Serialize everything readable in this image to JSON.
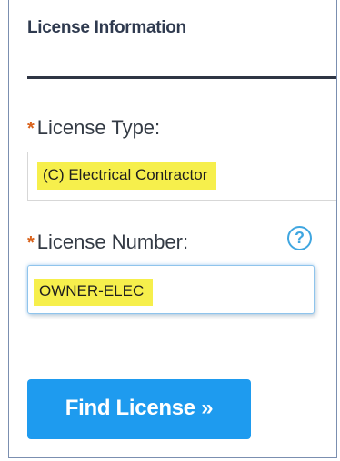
{
  "panel": {
    "title": "License Information"
  },
  "license_type": {
    "required_marker": "*",
    "label": "License Type:",
    "value": "(C) Electrical Contractor"
  },
  "license_number": {
    "required_marker": "*",
    "label": "License Number:",
    "value": "OWNER-ELEC",
    "help_icon": "?"
  },
  "actions": {
    "find_label": "Find License »"
  },
  "colors": {
    "highlight": "#f6ef4c",
    "button": "#1e9bef",
    "required": "#d9621b",
    "help": "#3fa6e0"
  }
}
